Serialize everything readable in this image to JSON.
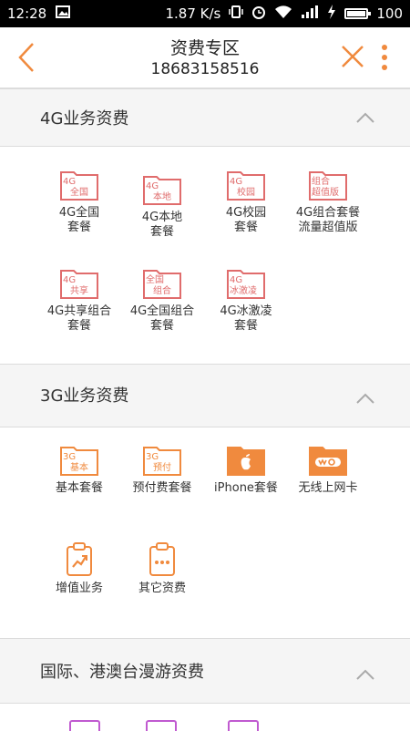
{
  "status_bar": {
    "time": "12:28",
    "speed": "1.87 K/s",
    "battery": "100"
  },
  "header": {
    "title": "资费专区",
    "phone": "18683158516"
  },
  "colors": {
    "accent": "#f08a3e",
    "red_icon": "#e06c6c",
    "purple_icon": "#c05ad0"
  },
  "sections": [
    {
      "title": "4G业务资费",
      "items": [
        {
          "icon_label": "4G|全国",
          "label": "4G全国\n套餐"
        },
        {
          "icon_label": "4G|本地",
          "label": "4G本地\n套餐"
        },
        {
          "icon_label": "4G|校园",
          "label": "4G校园\n套餐"
        },
        {
          "icon_label": "组合|超值版",
          "label": "4G组合套餐\n流量超值版"
        },
        {
          "icon_label": "4G|共享",
          "label": "4G共享组合\n套餐"
        },
        {
          "icon_label": "全国|组合",
          "label": "4G全国组合\n套餐"
        },
        {
          "icon_label": "4G|冰激凌",
          "label": "4G冰激凌\n套餐"
        }
      ]
    },
    {
      "title": "3G业务资费",
      "items": [
        {
          "icon_label": "3G|基本",
          "label": "基本套餐"
        },
        {
          "icon_label": "3G|预付",
          "label": "预付费套餐"
        },
        {
          "icon_name": "apple-icon",
          "label": "iPhone套餐"
        },
        {
          "icon_name": "wo-icon",
          "label": "无线上网卡"
        },
        {
          "icon_name": "chart-clipboard-icon",
          "label": "增值业务"
        },
        {
          "icon_name": "dots-clipboard-icon",
          "label": "其它资费"
        }
      ]
    },
    {
      "title": "国际、港澳台漫游资费"
    }
  ]
}
